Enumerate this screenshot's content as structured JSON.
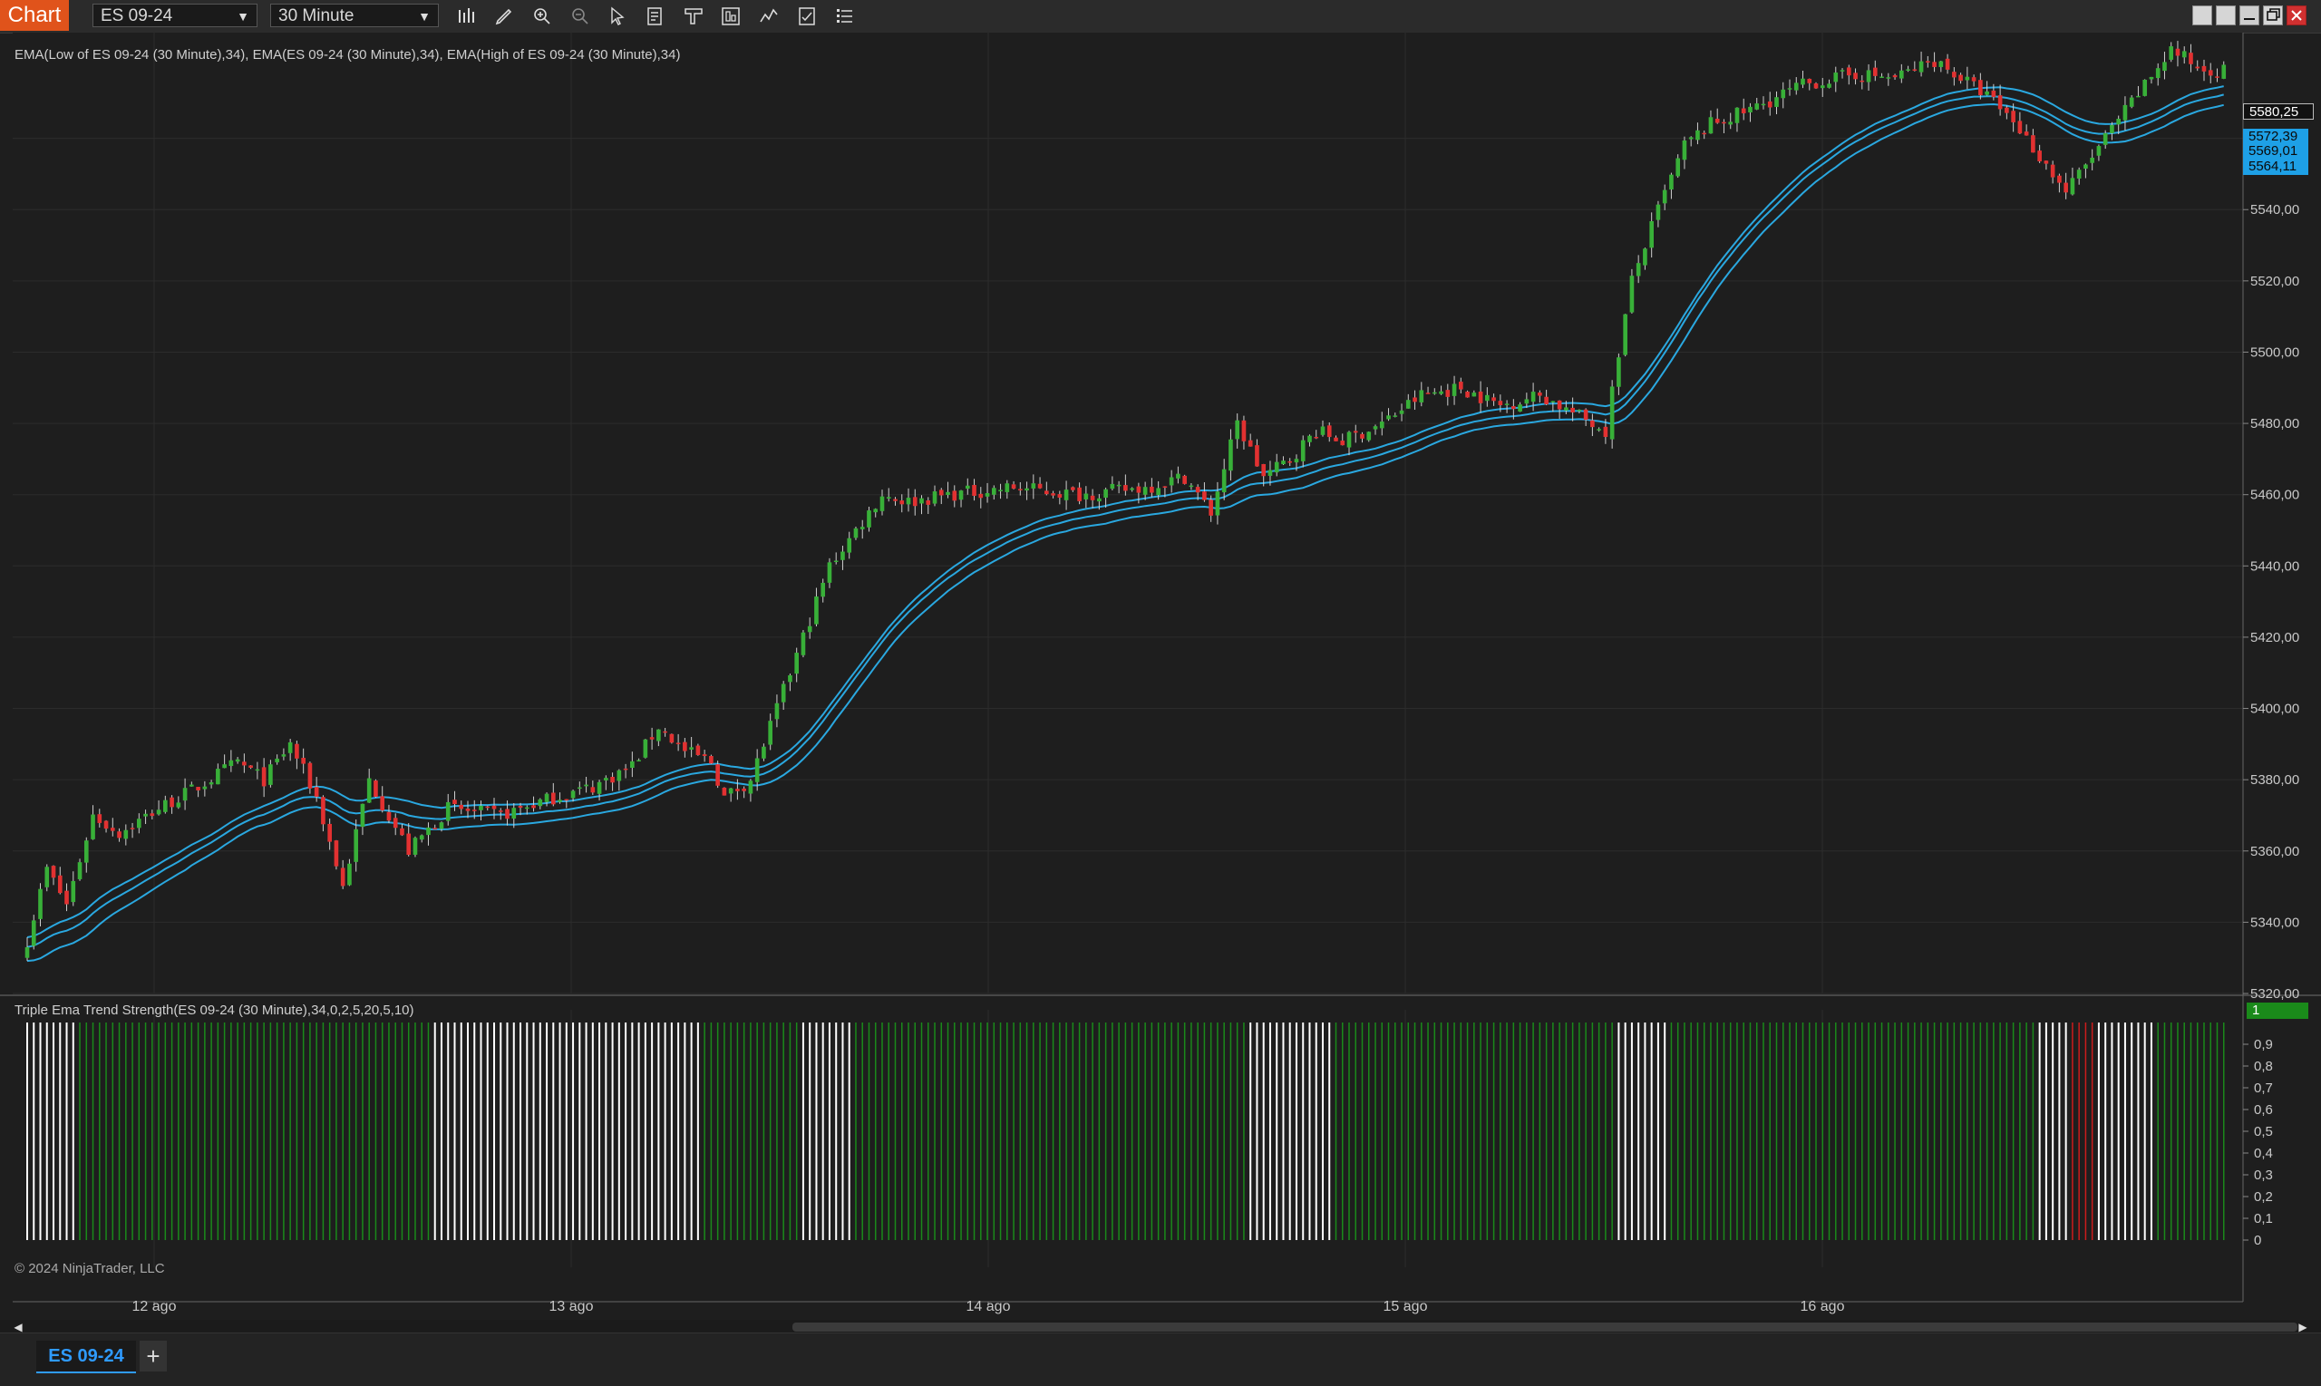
{
  "toolbar": {
    "chart_label": "Chart",
    "instrument": "ES 09-24",
    "interval": "30 Minute",
    "icons": [
      "bar-chart-icon",
      "draw-pencil-icon",
      "zoom-in-icon",
      "zoom-out-icon",
      "pointer-icon",
      "data-box-icon",
      "template-icon",
      "properties-icon",
      "indicator-icon",
      "strategy-icon",
      "list-icon"
    ]
  },
  "window": {
    "buttons": [
      "link-icon",
      "link-icon",
      "minimize-icon",
      "restore-icon",
      "close-icon"
    ]
  },
  "colors": {
    "background": "#1e1e1e",
    "grid": "#2c2c2c",
    "up_candle": "#38b038",
    "down_candle": "#e23131",
    "ema_line": "#2aa8e0",
    "strength_strong": "#1a8a1a",
    "strength_neutral": "#ffffff",
    "strength_weak": "#cc1c1c",
    "price_tag_bg": "#1ea0e6"
  },
  "main_panel": {
    "ema_label": "EMA(Low of ES 09-24 (30 Minute),34), EMA(ES 09-24 (30 Minute),34), EMA(High of ES 09-24 (30 Minute),34)",
    "price_ticks": [
      "5320,00",
      "5340,00",
      "5360,00",
      "5380,00",
      "5400,00",
      "5420,00",
      "5440,00",
      "5460,00",
      "5480,00",
      "5500,00",
      "5520,00",
      "5540,00",
      "5560,00"
    ],
    "last_price": "5580,25",
    "ema_high_value": "5572,39",
    "ema_mid_value": "5569,01",
    "ema_low_value": "5564,11"
  },
  "indicator_panel": {
    "label": "Triple Ema Trend Strength(ES 09-24 (30 Minute),34,0,2,5,20,5,10)",
    "value_ticks": [
      "0",
      "0,1",
      "0,2",
      "0,3",
      "0,4",
      "0,5",
      "0,6",
      "0,7",
      "0,8",
      "0,9"
    ],
    "current_value": "1",
    "copyright": "© 2024 NinjaTrader, LLC"
  },
  "time_axis": {
    "labels": [
      "12 ago",
      "13 ago",
      "14 ago",
      "15 ago",
      "16 ago"
    ]
  },
  "tabs": {
    "active": "ES 09-24",
    "add": "+"
  },
  "chart_data": {
    "type": "candlestick",
    "title": "",
    "ylim": [
      5320,
      5580
    ],
    "x_labels": [
      "12 ago",
      "13 ago",
      "14 ago",
      "15 ago",
      "16 ago"
    ],
    "close_path": [
      [
        0,
        5335
      ],
      [
        3,
        5355
      ],
      [
        6,
        5345
      ],
      [
        10,
        5370
      ],
      [
        14,
        5365
      ],
      [
        20,
        5372
      ],
      [
        26,
        5378
      ],
      [
        32,
        5385
      ],
      [
        36,
        5380
      ],
      [
        40,
        5390
      ],
      [
        44,
        5375
      ],
      [
        48,
        5350
      ],
      [
        52,
        5380
      ],
      [
        55,
        5370
      ],
      [
        58,
        5360
      ],
      [
        64,
        5372
      ],
      [
        72,
        5370
      ],
      [
        80,
        5375
      ],
      [
        86,
        5378
      ],
      [
        92,
        5384
      ],
      [
        96,
        5395
      ],
      [
        100,
        5388
      ],
      [
        104,
        5385
      ],
      [
        106,
        5375
      ],
      [
        110,
        5380
      ],
      [
        114,
        5400
      ],
      [
        118,
        5420
      ],
      [
        122,
        5440
      ],
      [
        126,
        5450
      ],
      [
        130,
        5460
      ],
      [
        134,
        5458
      ],
      [
        140,
        5460
      ],
      [
        150,
        5462
      ],
      [
        160,
        5460
      ],
      [
        170,
        5462
      ],
      [
        176,
        5465
      ],
      [
        180,
        5455
      ],
      [
        184,
        5480
      ],
      [
        188,
        5465
      ],
      [
        192,
        5470
      ],
      [
        196,
        5478
      ],
      [
        200,
        5475
      ],
      [
        206,
        5480
      ],
      [
        212,
        5488
      ],
      [
        218,
        5490
      ],
      [
        224,
        5485
      ],
      [
        230,
        5488
      ],
      [
        236,
        5482
      ],
      [
        240,
        5478
      ],
      [
        242,
        5500
      ],
      [
        244,
        5520
      ],
      [
        248,
        5540
      ],
      [
        252,
        5558
      ],
      [
        256,
        5564
      ],
      [
        262,
        5568
      ],
      [
        270,
        5575
      ],
      [
        278,
        5578
      ],
      [
        284,
        5577
      ],
      [
        290,
        5582
      ],
      [
        294,
        5577
      ],
      [
        298,
        5572
      ],
      [
        302,
        5565
      ],
      [
        306,
        5555
      ],
      [
        310,
        5545
      ],
      [
        314,
        5555
      ],
      [
        318,
        5565
      ],
      [
        322,
        5575
      ],
      [
        326,
        5585
      ],
      [
        330,
        5580
      ],
      [
        334,
        5579
      ]
    ],
    "ema": {
      "period": 34,
      "series": [
        {
          "name": "EMA(High of ES 09-24 (30 Minute),34)"
        },
        {
          "name": "EMA(ES 09-24 (30 Minute),34)"
        },
        {
          "name": "EMA(Low of ES 09-24 (30 Minute),34)"
        }
      ]
    },
    "strength_segments": [
      {
        "from": 0,
        "to": 8,
        "state": "neutral"
      },
      {
        "from": 8,
        "to": 62,
        "state": "strong"
      },
      {
        "from": 62,
        "to": 103,
        "state": "neutral"
      },
      {
        "from": 103,
        "to": 118,
        "state": "strong"
      },
      {
        "from": 118,
        "to": 126,
        "state": "neutral"
      },
      {
        "from": 126,
        "to": 186,
        "state": "strong"
      },
      {
        "from": 186,
        "to": 199,
        "state": "neutral"
      },
      {
        "from": 199,
        "to": 242,
        "state": "strong"
      },
      {
        "from": 242,
        "to": 250,
        "state": "neutral"
      },
      {
        "from": 250,
        "to": 306,
        "state": "strong"
      },
      {
        "from": 306,
        "to": 311,
        "state": "neutral"
      },
      {
        "from": 311,
        "to": 315,
        "state": "weak"
      },
      {
        "from": 315,
        "to": 324,
        "state": "neutral"
      },
      {
        "from": 324,
        "to": 335,
        "state": "strong"
      }
    ]
  }
}
